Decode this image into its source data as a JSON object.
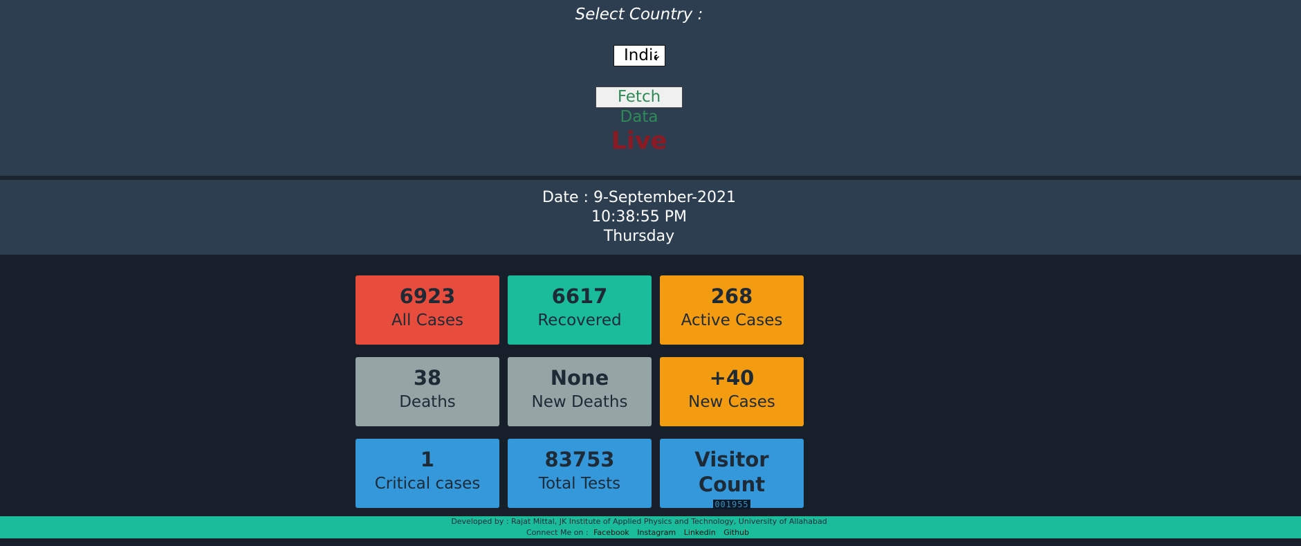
{
  "header": {
    "select_label": "Select Country :",
    "country_selected": "India",
    "fetch_button": "Fetch Data",
    "live_label": "Live"
  },
  "datetime": {
    "date": "Date : 9-September-2021",
    "time": "10:38:55 PM",
    "day": "Thursday"
  },
  "cards": [
    {
      "value": "6923",
      "label": "All Cases",
      "color": "#e74c3c"
    },
    {
      "value": "6617",
      "label": "Recovered",
      "color": "#1abc9c"
    },
    {
      "value": "268",
      "label": "Active Cases",
      "color": "#f39c12"
    },
    {
      "value": "38",
      "label": "Deaths",
      "color": "#95a5a6"
    },
    {
      "value": "None",
      "label": "New Deaths",
      "color": "#95a5a6"
    },
    {
      "value": "+40",
      "label": "New Cases",
      "color": "#f39c12"
    },
    {
      "value": "1",
      "label": "Critical cases",
      "color": "#3498db"
    },
    {
      "value": "83753",
      "label": "Total Tests",
      "color": "#3498db"
    }
  ],
  "visitor": {
    "title": "Visitor Count",
    "count": "001955",
    "color": "#3498db"
  },
  "footer": {
    "developed_by": "Developed by : Rajat Mittal,   JK Institute of Applied Physics and Technology, University of Allahabad",
    "connect_label": "Connect Me on :",
    "links": [
      "Facebook",
      "Instagram",
      "Linkedin",
      "Github"
    ]
  }
}
